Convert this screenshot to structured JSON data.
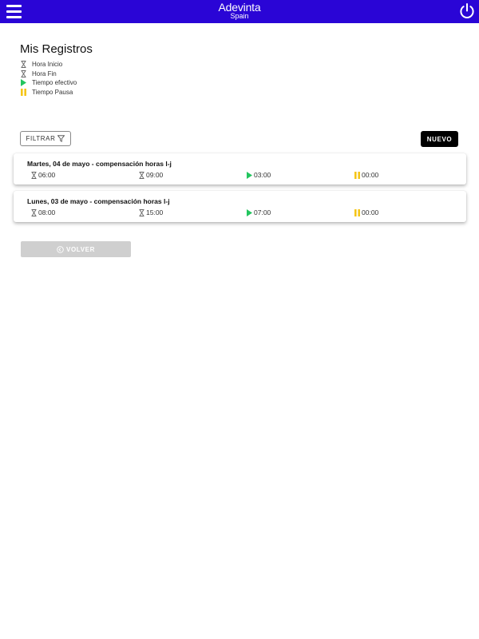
{
  "header": {
    "brand_name": "Adevinta",
    "brand_sub": "Spain",
    "bar_color": "#2a05d6"
  },
  "page": {
    "title": "Mis Registros"
  },
  "legend": {
    "items": [
      {
        "icon": "hourglass-icon",
        "label": "Hora Inicio"
      },
      {
        "icon": "hourglass-icon",
        "label": "Hora Fin"
      },
      {
        "icon": "play-icon",
        "label": "Tiempo efectivo"
      },
      {
        "icon": "pause-icon",
        "label": "Tiempo Pausa"
      }
    ]
  },
  "toolbar": {
    "filter_label": "FILTRAR",
    "new_label": "NUEVO"
  },
  "records": [
    {
      "title": "Martes, 04 de mayo - compensación horas l-j",
      "start": "06:00",
      "end": "09:00",
      "effective": "03:00",
      "pause": "00:00"
    },
    {
      "title": "Lunes, 03 de mayo - compensación horas l-j",
      "start": "08:00",
      "end": "15:00",
      "effective": "07:00",
      "pause": "00:00"
    }
  ],
  "footer": {
    "back_label": "VOLVER"
  },
  "colors": {
    "play": "#22c55e",
    "pause": "#f5c518",
    "accent": "#2a05d6"
  }
}
